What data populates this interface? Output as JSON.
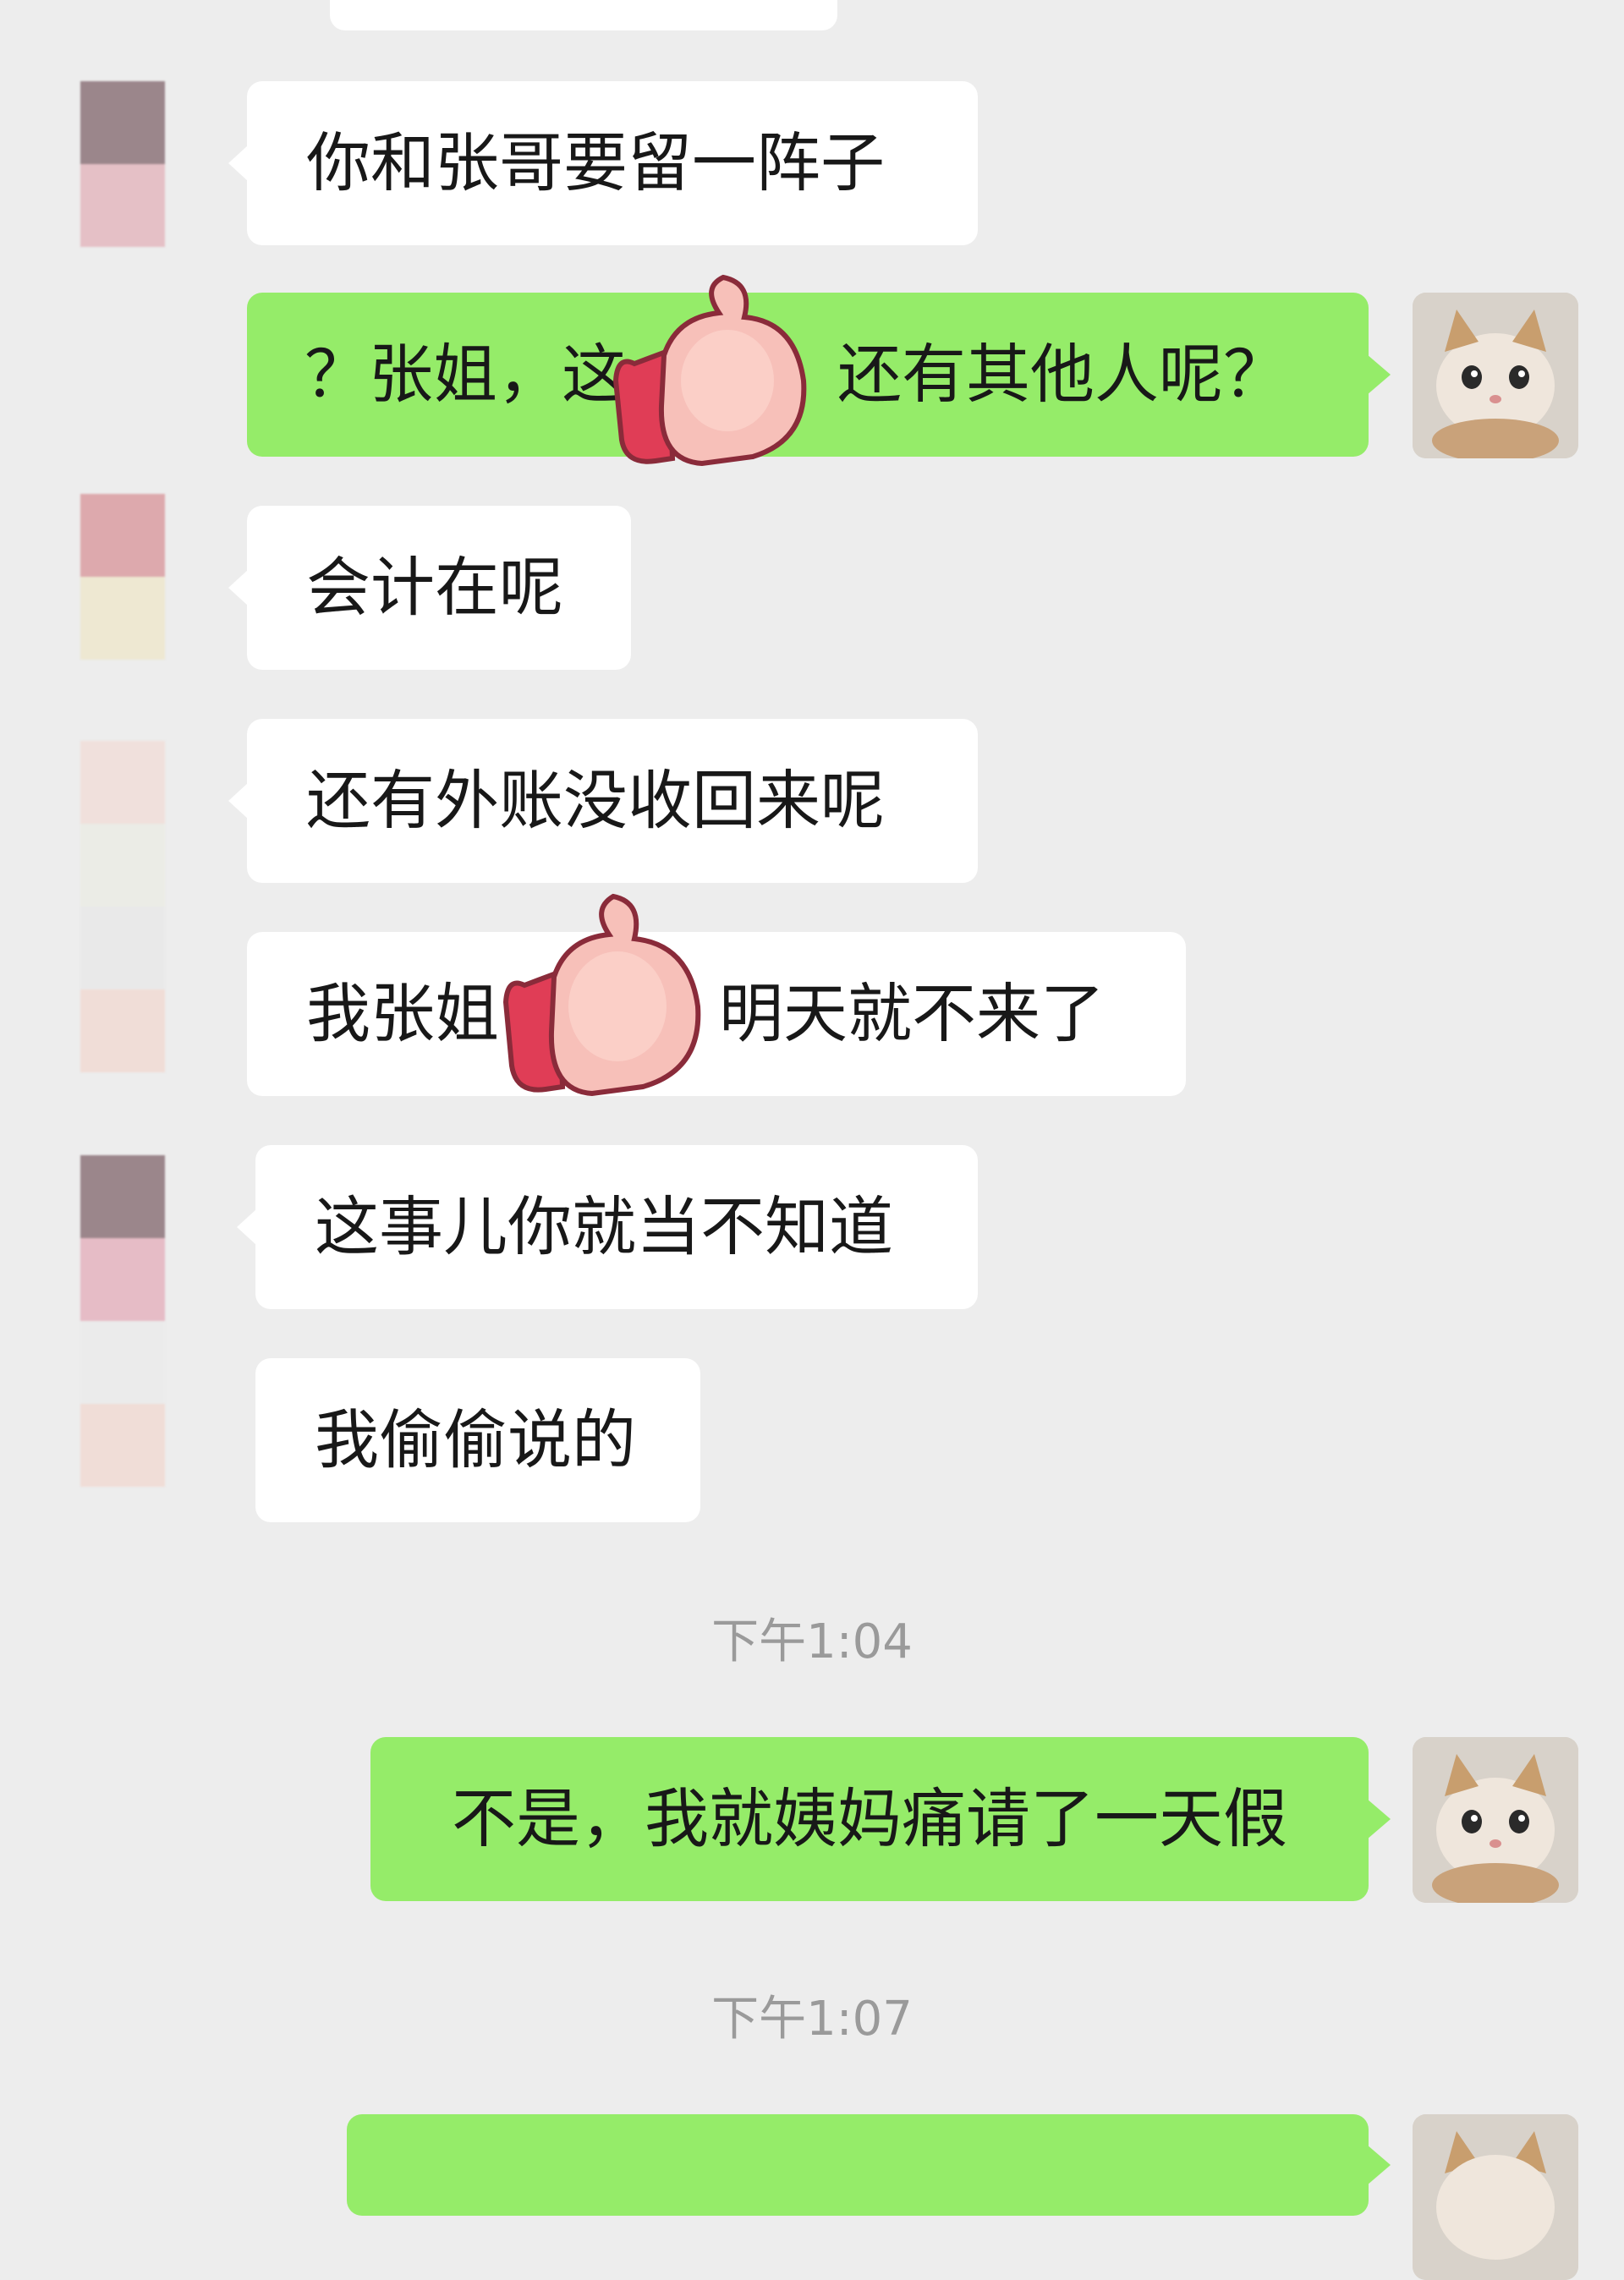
{
  "colors": {
    "background": "#ededed",
    "incoming_bubble": "#ffffff",
    "outgoing_bubble": "#95ec69",
    "timestamp_text": "#9a9a9a"
  },
  "messages": [
    {
      "side": "in",
      "text": "你和张哥要留一阵子"
    },
    {
      "side": "out",
      "text_left": "？张姐，",
      "text_partial": "这",
      "text_right": "还有其他人呢？",
      "sticker": "thumbs-up-sticker"
    },
    {
      "side": "in",
      "text": "会计在呢"
    },
    {
      "side": "in",
      "text": "还有外账没收回来呢"
    },
    {
      "side": "in",
      "text_left": "我张姐",
      "text_right": "明天就不来了",
      "sticker": "thumbs-up-sticker"
    },
    {
      "side": "in",
      "text": "这事儿你就当不知道"
    },
    {
      "side": "in",
      "text": "我偷偷说的"
    },
    {
      "side": "out",
      "text": "不是，我就姨妈痛请了一天假"
    }
  ],
  "timestamps": [
    "下午1:04",
    "下午1:07"
  ]
}
